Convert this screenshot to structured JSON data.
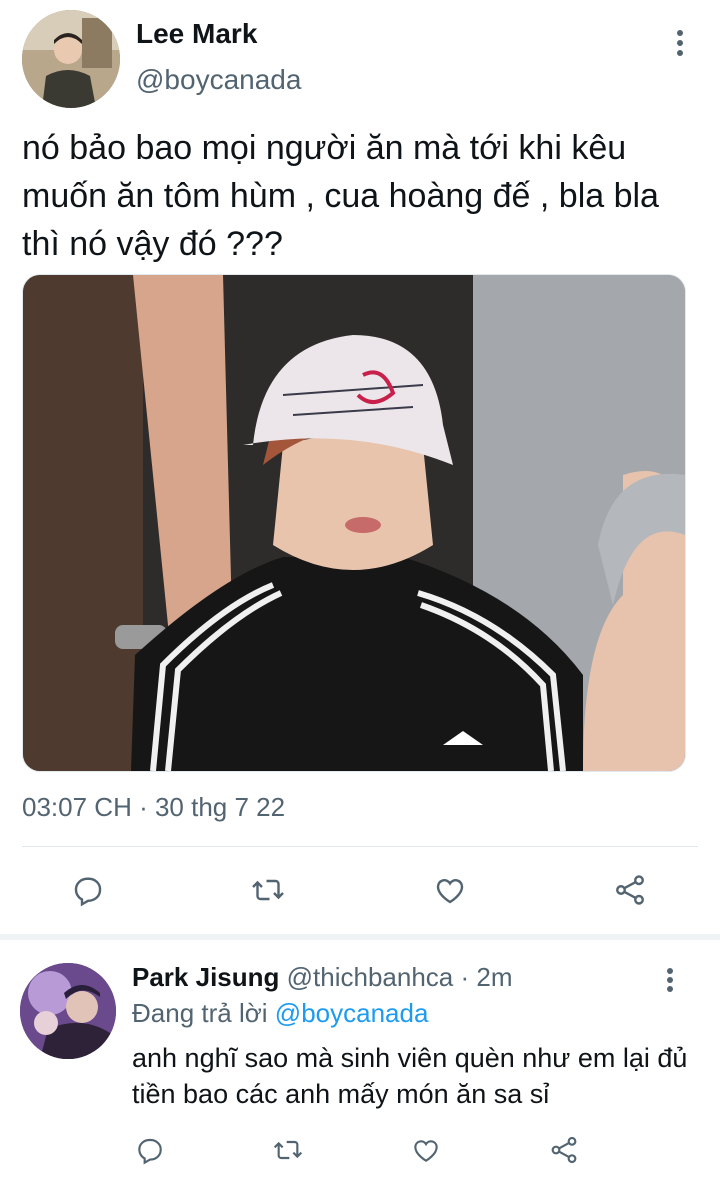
{
  "tweet": {
    "author_name": "Lee Mark",
    "author_handle": "@boycanada",
    "text": "nó bảo bao mọi người ăn mà tới khi kêu muốn ăn tôm hùm , cua hoàng đế , bla bla thì nó vậy đó ???",
    "timestamp": "03:07 CH · 30 thg 7 22",
    "actions": [
      "reply-icon",
      "retweet-icon",
      "like-icon",
      "share-icon"
    ]
  },
  "reply": {
    "author_name": "Park Jisung",
    "author_handle": "@thichbanhca",
    "time": "· 2m",
    "replying_prefix": "Đang trả lời",
    "replying_to": "@boycanada",
    "text": "anh nghĩ sao mà sinh viên quèn như em lại đủ tiền bao các anh mấy món ăn sa sỉ",
    "actions": [
      "reply-icon",
      "retweet-icon",
      "like-icon",
      "share-icon"
    ]
  },
  "colors": {
    "text": "#0f1419",
    "secondary": "#536471",
    "link": "#1d9bf0",
    "divider": "#e1e8ed"
  }
}
